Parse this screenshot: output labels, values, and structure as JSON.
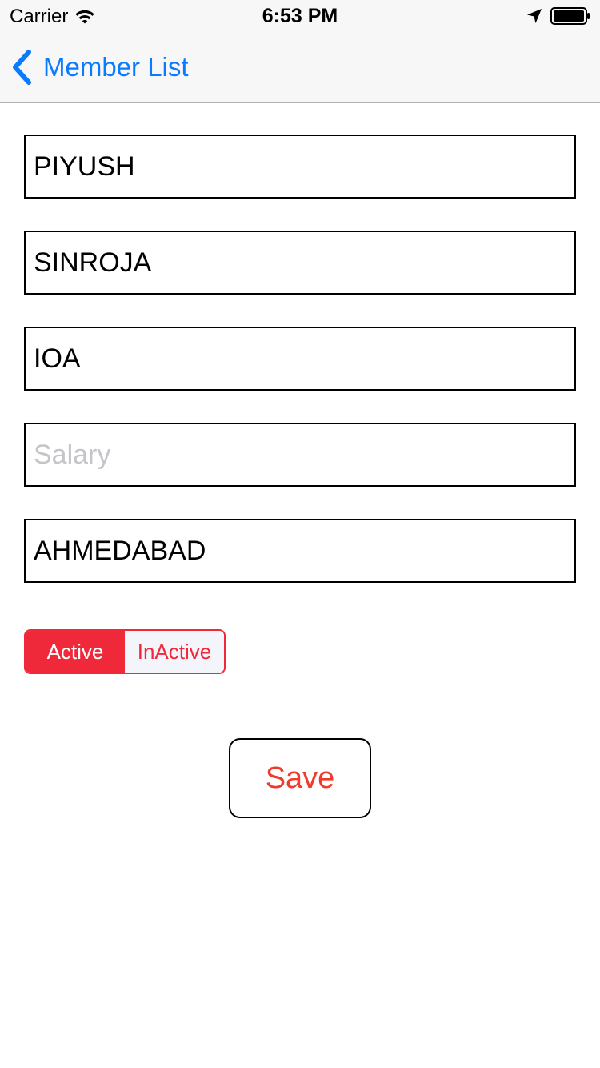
{
  "status_bar": {
    "carrier": "Carrier",
    "time": "6:53 PM",
    "icons": [
      "wifi-icon",
      "location-arrow-icon",
      "battery-icon"
    ]
  },
  "nav": {
    "back_label": "Member List",
    "back_icon": "chevron-left-icon",
    "tint_color": "#0a7aff"
  },
  "form": {
    "first_name": {
      "value": "PIYUSH",
      "placeholder": ""
    },
    "last_name": {
      "value": "SINROJA",
      "placeholder": ""
    },
    "department": {
      "value": "IOA",
      "placeholder": ""
    },
    "salary": {
      "value": "",
      "placeholder": "Salary"
    },
    "city": {
      "value": "AHMEDABAD",
      "placeholder": ""
    }
  },
  "status_segment": {
    "options": [
      "Active",
      "InActive"
    ],
    "selected": "Active",
    "tint_color": "#f0293a"
  },
  "save_button": {
    "label": "Save",
    "color": "#f23a2c"
  }
}
